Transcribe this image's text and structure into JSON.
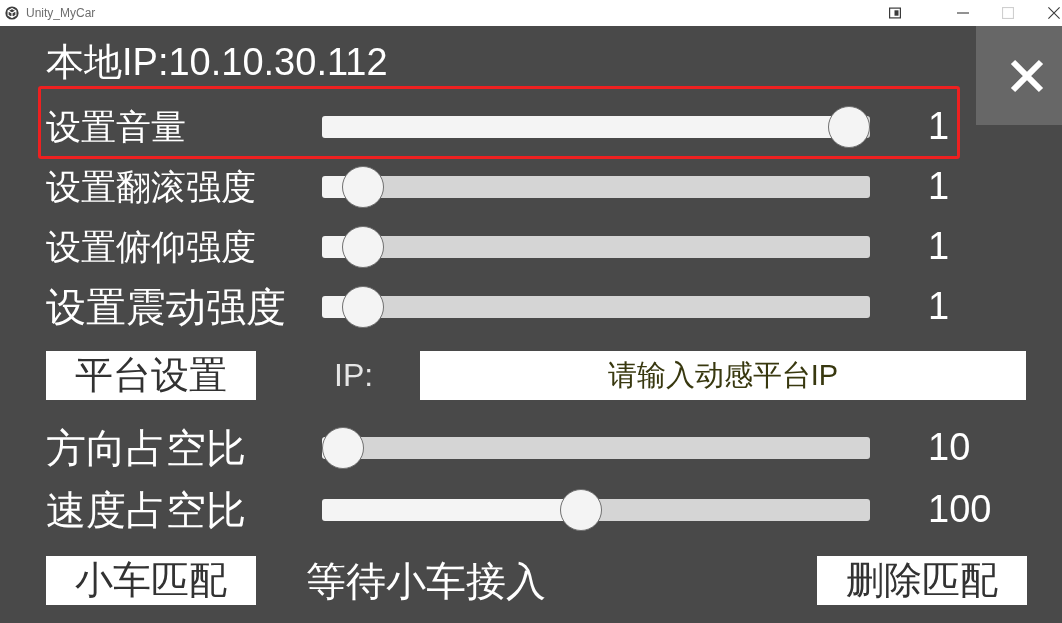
{
  "window": {
    "title": "Unity_MyCar",
    "controls": [
      {
        "kind": "layout",
        "disabled": false
      },
      {
        "kind": "minimize",
        "disabled": false
      },
      {
        "kind": "maximize",
        "disabled": true
      },
      {
        "kind": "close",
        "disabled": false
      }
    ]
  },
  "local_ip": "本地IP:10.10.30.112",
  "settings_sliders": [
    {
      "label": "设置音量",
      "level": 1,
      "reading": "1",
      "highlighted": true
    },
    {
      "label": "设置翻滚强度",
      "level": 0.04,
      "reading": "1",
      "highlighted": false
    },
    {
      "label": "设置俯仰强度",
      "level": 0.04,
      "reading": "1",
      "highlighted": false
    },
    {
      "label": "设置震动强度",
      "level": 0.04,
      "reading": "1",
      "highlighted": false
    }
  ],
  "platform": {
    "button": "平台设置",
    "ip_label": "IP:",
    "ip_field": {
      "placeholder": "请输入动感平台IP"
    }
  },
  "duty_sliders": [
    {
      "label": "方向占空比",
      "level": 0,
      "reading": "10"
    },
    {
      "label": "速度占空比",
      "level": 0.47,
      "reading": "100"
    }
  ],
  "pairing": {
    "button": "小车匹配",
    "status": "等待小车接入",
    "delete_button": "删除匹配"
  }
}
